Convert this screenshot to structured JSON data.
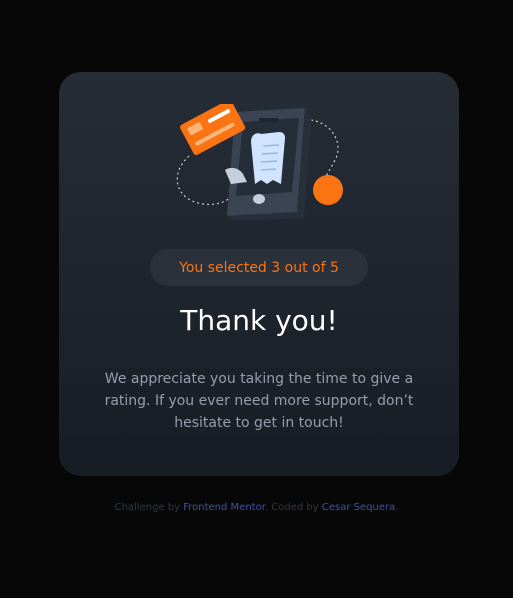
{
  "card": {
    "illustration_icon": "payment-phone-illustration",
    "badge_text": "You selected 3 out of 5",
    "title": "Thank you!",
    "message": "We appreciate you taking the time to give a rating. If you ever need more support, don’t hesitate to get in touch!"
  },
  "attribution": {
    "prefix": "Challenge by ",
    "challenge_link": "Frontend Mentor",
    "middle": ". Coded by ",
    "author_link": "Cesar Sequera",
    "suffix": "."
  },
  "colors": {
    "accent": "#fb7413",
    "background": "#070707",
    "card": "#202731",
    "text_muted": "#959eac",
    "link": "#3e52a3"
  }
}
